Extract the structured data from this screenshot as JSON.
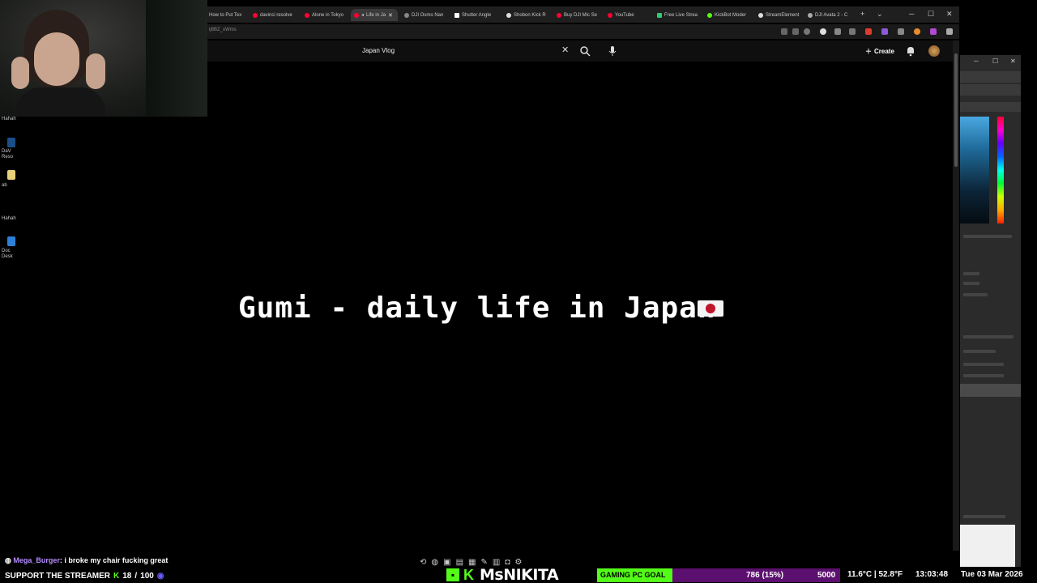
{
  "browser": {
    "tabs": [
      {
        "label": "How to Put Tex",
        "favicon_color": "#777777"
      },
      {
        "label": "davinci resolve",
        "favicon_color": "#ff0033"
      },
      {
        "label": "Alone in Tokyo",
        "favicon_color": "#ff0033"
      },
      {
        "label": "Life in Ja",
        "favicon_color": "#ff0033",
        "active": true
      },
      {
        "label": "DJI Osmo Nan",
        "favicon_color": "#888888"
      },
      {
        "label": "Shutter Angle",
        "favicon_color": "#ffffff"
      },
      {
        "label": "Shobon Kick R",
        "favicon_color": "#dddddd"
      },
      {
        "label": "Buy DJI Mic Se",
        "favicon_color": "#ff0033"
      },
      {
        "label": "YouTube",
        "favicon_color": "#ff0033"
      },
      {
        "label": "Free Live Strea",
        "favicon_color": "#2ecc71"
      },
      {
        "label": "KickBot Moder",
        "favicon_color": "#53fc18"
      },
      {
        "label": "StreamElement",
        "favicon_color": "#dddddd"
      },
      {
        "label": "DJI Avata 2 - C",
        "favicon_color": "#aaaaaa"
      }
    ],
    "new_tab": "+",
    "tab_menu": "⌄",
    "window_minimize": "─",
    "window_maximize": "☐",
    "window_close": "✕",
    "url": "ij8BZ_xWms"
  },
  "youtube": {
    "search_value": "Japan Vlog",
    "clear": "✕",
    "create_label": "Create"
  },
  "video": {
    "title": "Gumi - daily life in Japan"
  },
  "desktop": {
    "labels": [
      "Hahah",
      "DaV",
      "Reso",
      "ab",
      "Hahah",
      "Doc",
      "Desk"
    ]
  },
  "stream_overlay": {
    "chat_user": "Mega_Burger",
    "chat_message": ": i broke my chair fucking great",
    "support_label": "SUPPORT THE STREAMER",
    "support_count": "18",
    "support_target": "100",
    "streamer_name": "MsNIKITA",
    "kick_letter": "K",
    "goal_label": "GAMING PC GOAL",
    "goal_progress": "786 (15%)",
    "goal_target": "5000",
    "goal_fraction": 0.15,
    "weather": "11.6°C | 52.8°F",
    "time": "13:03:48",
    "date": "Tue 03 Mar 2026"
  },
  "colors": {
    "kick_green": "#53fc18",
    "goal_purple": "#5b0f6e",
    "chat_user": "#b58cff"
  }
}
